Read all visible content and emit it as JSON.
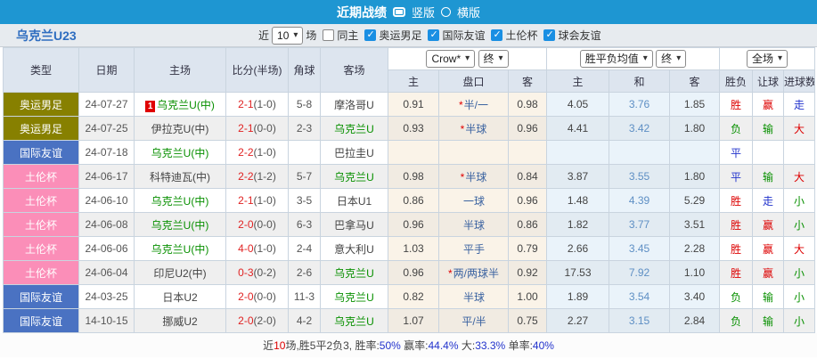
{
  "colors": {
    "topbar_bg": "#1E96D2",
    "olympic_bg": "#878000",
    "friendly_bg": "#4A72C2",
    "toulon_bg": "#FB8EB8",
    "win_red": "#DD0000",
    "lose_green": "#089000",
    "draw_blue": "#2233CC",
    "handicap_blue": "#3A62A0",
    "team_green": "#089000",
    "odds_col_bg": "#FAF3E8",
    "avg_col_bg": "#EAF3FA"
  },
  "title_bar": {
    "title": "近期战绩",
    "radios": [
      {
        "label": "竖版",
        "selected": true
      },
      {
        "label": "横版",
        "selected": false
      }
    ]
  },
  "filter_bar": {
    "team": "乌克兰U23",
    "near_label": "近",
    "count_value": "10",
    "count_suffix": "场",
    "checkboxes": [
      {
        "label": "同主",
        "checked": false
      },
      {
        "label": "奥运男足",
        "checked": true
      },
      {
        "label": "国际友谊",
        "checked": true
      },
      {
        "label": "土伦杯",
        "checked": true
      },
      {
        "label": "球会友谊",
        "checked": true
      }
    ]
  },
  "selects": {
    "company": "Crow*",
    "company_time": "终",
    "avg_type": "胜平负均值",
    "avg_time": "终",
    "scope": "全场"
  },
  "table": {
    "headers": {
      "type": "类型",
      "date": "日期",
      "home": "主场",
      "score": "比分(半场)",
      "corner": "角球",
      "away": "客场",
      "odds_home": "主",
      "handicap": "盘口",
      "odds_away": "客",
      "avg_home": "主",
      "avg_draw": "和",
      "avg_away": "客",
      "result": "胜负",
      "spread": "让球",
      "goals": "进球数"
    },
    "rows": [
      {
        "shade": "light",
        "type": "奥运男足",
        "type_class": "olympic",
        "date": "24-07-27",
        "red_card": "1",
        "home": "乌克兰U(中)",
        "home_class": "green",
        "score": "2-1",
        "half": "(1-0)",
        "corner": "5-8",
        "away": "摩洛哥U",
        "away_class": "dark",
        "odds_home": "0.91",
        "handicap_star": "*",
        "handicap": "半/一",
        "odds_away": "0.98",
        "avg_home": "4.05",
        "avg_draw": "3.76",
        "avg_away": "1.85",
        "result": "胜",
        "result_class": "red",
        "spread": "赢",
        "spread_class": "red",
        "goals": "走",
        "goals_class": "blue"
      },
      {
        "shade": "dark",
        "type": "奥运男足",
        "type_class": "olympic",
        "date": "24-07-25",
        "red_card": "",
        "home": "伊拉克U(中)",
        "home_class": "dark",
        "score": "2-1",
        "half": "(0-0)",
        "corner": "2-3",
        "away": "乌克兰U",
        "away_class": "green",
        "odds_home": "0.93",
        "handicap_star": "*",
        "handicap": "半球",
        "odds_away": "0.96",
        "avg_home": "4.41",
        "avg_draw": "3.42",
        "avg_away": "1.80",
        "result": "负",
        "result_class": "green",
        "spread": "输",
        "spread_class": "green",
        "goals": "大",
        "goals_class": "red"
      },
      {
        "shade": "light",
        "type": "国际友谊",
        "type_class": "friendly",
        "date": "24-07-18",
        "red_card": "",
        "home": "乌克兰U(中)",
        "home_class": "green",
        "score": "2-2",
        "half": "(1-0)",
        "corner": "",
        "away": "巴拉圭U",
        "away_class": "dark",
        "odds_home": "",
        "handicap_star": "",
        "handicap": "",
        "odds_away": "",
        "avg_home": "",
        "avg_draw": "",
        "avg_away": "",
        "result": "平",
        "result_class": "blue",
        "spread": "",
        "spread_class": "",
        "goals": "",
        "goals_class": ""
      },
      {
        "shade": "dark",
        "type": "土伦杯",
        "type_class": "toulon",
        "date": "24-06-17",
        "red_card": "",
        "home": "科特迪瓦(中)",
        "home_class": "dark",
        "score": "2-2",
        "half": "(1-2)",
        "corner": "5-7",
        "away": "乌克兰U",
        "away_class": "green",
        "odds_home": "0.98",
        "handicap_star": "*",
        "handicap": "半球",
        "odds_away": "0.84",
        "avg_home": "3.87",
        "avg_draw": "3.55",
        "avg_away": "1.80",
        "result": "平",
        "result_class": "blue",
        "spread": "输",
        "spread_class": "green",
        "goals": "大",
        "goals_class": "red"
      },
      {
        "shade": "light",
        "type": "土伦杯",
        "type_class": "toulon",
        "date": "24-06-10",
        "red_card": "",
        "home": "乌克兰U(中)",
        "home_class": "green",
        "score": "2-1",
        "half": "(1-0)",
        "corner": "3-5",
        "away": "日本U1",
        "away_class": "dark",
        "odds_home": "0.86",
        "handicap_star": "",
        "handicap": "一球",
        "odds_away": "0.96",
        "avg_home": "1.48",
        "avg_draw": "4.39",
        "avg_away": "5.29",
        "result": "胜",
        "result_class": "red",
        "spread": "走",
        "spread_class": "blue",
        "goals": "小",
        "goals_class": "green"
      },
      {
        "shade": "dark",
        "type": "土伦杯",
        "type_class": "toulon",
        "date": "24-06-08",
        "red_card": "",
        "home": "乌克兰U(中)",
        "home_class": "green",
        "score": "2-0",
        "half": "(0-0)",
        "corner": "6-3",
        "away": "巴拿马U",
        "away_class": "dark",
        "odds_home": "0.96",
        "handicap_star": "",
        "handicap": "半球",
        "odds_away": "0.86",
        "avg_home": "1.82",
        "avg_draw": "3.77",
        "avg_away": "3.51",
        "result": "胜",
        "result_class": "red",
        "spread": "赢",
        "spread_class": "red",
        "goals": "小",
        "goals_class": "green"
      },
      {
        "shade": "light",
        "type": "土伦杯",
        "type_class": "toulon",
        "date": "24-06-06",
        "red_card": "",
        "home": "乌克兰U(中)",
        "home_class": "green",
        "score": "4-0",
        "half": "(1-0)",
        "corner": "2-4",
        "away": "意大利U",
        "away_class": "dark",
        "odds_home": "1.03",
        "handicap_star": "",
        "handicap": "平手",
        "odds_away": "0.79",
        "avg_home": "2.66",
        "avg_draw": "3.45",
        "avg_away": "2.28",
        "result": "胜",
        "result_class": "red",
        "spread": "赢",
        "spread_class": "red",
        "goals": "大",
        "goals_class": "red"
      },
      {
        "shade": "dark",
        "type": "土伦杯",
        "type_class": "toulon",
        "date": "24-06-04",
        "red_card": "",
        "home": "印尼U2(中)",
        "home_class": "dark",
        "score": "0-3",
        "half": "(0-2)",
        "corner": "2-6",
        "away": "乌克兰U",
        "away_class": "green",
        "odds_home": "0.96",
        "handicap_star": "*",
        "handicap": "两/两球半",
        "odds_away": "0.92",
        "avg_home": "17.53",
        "avg_draw": "7.92",
        "avg_away": "1.10",
        "result": "胜",
        "result_class": "red",
        "spread": "赢",
        "spread_class": "red",
        "goals": "小",
        "goals_class": "green"
      },
      {
        "shade": "light",
        "type": "国际友谊",
        "type_class": "friendly",
        "date": "24-03-25",
        "red_card": "",
        "home": "日本U2",
        "home_class": "dark",
        "score": "2-0",
        "half": "(0-0)",
        "corner": "11-3",
        "away": "乌克兰U",
        "away_class": "green",
        "odds_home": "0.82",
        "handicap_star": "",
        "handicap": "半球",
        "odds_away": "1.00",
        "avg_home": "1.89",
        "avg_draw": "3.54",
        "avg_away": "3.40",
        "result": "负",
        "result_class": "green",
        "spread": "输",
        "spread_class": "green",
        "goals": "小",
        "goals_class": "green"
      },
      {
        "shade": "dark",
        "type": "国际友谊",
        "type_class": "friendly",
        "date": "14-10-15",
        "red_card": "",
        "home": "挪威U2",
        "home_class": "dark",
        "score": "2-0",
        "half": "(2-0)",
        "corner": "4-2",
        "away": "乌克兰U",
        "away_class": "green",
        "odds_home": "1.07",
        "handicap_star": "",
        "handicap": "平/半",
        "odds_away": "0.75",
        "avg_home": "2.27",
        "avg_draw": "3.15",
        "avg_away": "2.84",
        "result": "负",
        "result_class": "green",
        "spread": "输",
        "spread_class": "green",
        "goals": "小",
        "goals_class": "green"
      }
    ]
  },
  "footer": {
    "segments": [
      {
        "text": "近",
        "cls": "dark"
      },
      {
        "text": "10",
        "cls": "red"
      },
      {
        "text": "场,胜5平2负3, 胜率:",
        "cls": "dark"
      },
      {
        "text": "50%",
        "cls": "blue"
      },
      {
        "text": " 赢率:",
        "cls": "dark"
      },
      {
        "text": "44.4%",
        "cls": "blue"
      },
      {
        "text": " 大:",
        "cls": "dark"
      },
      {
        "text": "33.3%",
        "cls": "blue"
      },
      {
        "text": " 单率:",
        "cls": "dark"
      },
      {
        "text": "40%",
        "cls": "blue"
      }
    ]
  }
}
